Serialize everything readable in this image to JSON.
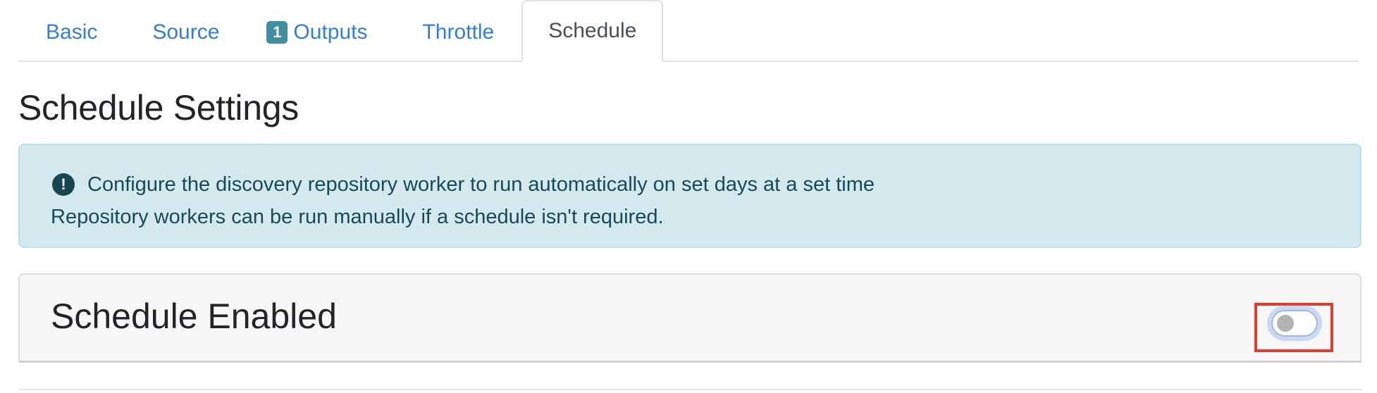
{
  "tabs": [
    {
      "label": "Basic",
      "active": false
    },
    {
      "label": "Source",
      "active": false
    },
    {
      "label": "Outputs",
      "active": false,
      "badge": "1"
    },
    {
      "label": "Throttle",
      "active": false
    },
    {
      "label": "Schedule",
      "active": true
    }
  ],
  "section": {
    "title": "Schedule Settings"
  },
  "alert": {
    "icon": "info-exclamation-icon",
    "line1": "Configure the discovery repository worker to run automatically on set days at a set time",
    "line2": "Repository workers can be run manually if a schedule isn't required."
  },
  "schedule": {
    "title": "Schedule Enabled",
    "enabled": false
  },
  "colors": {
    "link": "#2f7de1",
    "alert_bg": "#d4e9ee",
    "alert_text": "#174a58",
    "highlight": "#e53b2a",
    "badge": "#3f8fa3"
  }
}
